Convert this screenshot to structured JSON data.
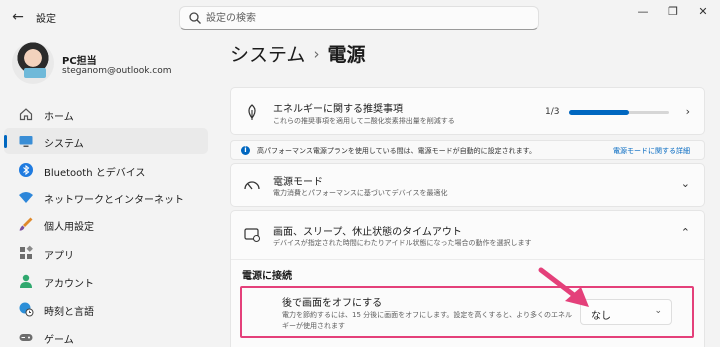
{
  "window": {
    "title": "設定",
    "back_icon": "back-arrow-icon"
  },
  "search": {
    "placeholder": "設定の検索",
    "value": ""
  },
  "window_controls": {
    "minimize": "—",
    "maximize": "❐",
    "close": "✕"
  },
  "profile": {
    "name": "PC担当",
    "email": "steganom@outlook.com"
  },
  "sidebar": {
    "items": [
      {
        "label": "ホーム",
        "icon": "home-icon",
        "active": false
      },
      {
        "label": "システム",
        "icon": "monitor-icon",
        "active": true
      },
      {
        "label": "Bluetooth とデバイス",
        "icon": "bluetooth-icon",
        "active": false
      },
      {
        "label": "ネットワークとインターネット",
        "icon": "wifi-icon",
        "active": false
      },
      {
        "label": "個人用設定",
        "icon": "brush-icon",
        "active": false
      },
      {
        "label": "アプリ",
        "icon": "apps-icon",
        "active": false
      },
      {
        "label": "アカウント",
        "icon": "account-icon",
        "active": false
      },
      {
        "label": "時刻と言語",
        "icon": "globe-clock-icon",
        "active": false
      },
      {
        "label": "ゲーム",
        "icon": "gamepad-icon",
        "active": false
      }
    ]
  },
  "breadcrumb": {
    "parent": "システム",
    "separator": "›",
    "current": "電源"
  },
  "recommendation": {
    "title": "エネルギーに関する推奨事項",
    "description": "これらの推奨事項を適用して二酸化炭素排出量を削減する",
    "progress_text": "1/3",
    "progress_fraction": 0.6
  },
  "banner": {
    "text": "高パフォーマンス電源プランを使用している間は、電源モードが自動的に設定されます。",
    "link": "電源モードに関する詳細"
  },
  "power_mode": {
    "title": "電源モード",
    "description": "電力消費とパフォーマンスに基づいてデバイスを最適化"
  },
  "timeouts": {
    "title": "画面、スリープ、休止状態のタイムアウト",
    "description": "デバイスが指定された時間にわたりアイドル状態になった場合の動作を選択します",
    "section_title": "電源に接続",
    "screen_off": {
      "title": "後で画面をオフにする",
      "description": "電力を節約するには、15 分後に画面をオフにします。設定を高くすると、より多くのエネルギーが使用されます",
      "value": "なし"
    }
  },
  "colors": {
    "accent": "#0067c0",
    "highlight": "#e4407a"
  }
}
